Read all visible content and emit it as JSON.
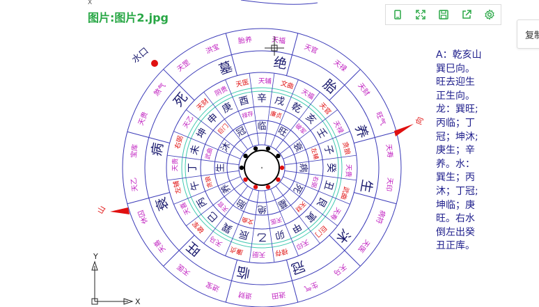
{
  "title": "图片:图片2.jpg",
  "toolbar": {
    "icons": [
      "fit-icon",
      "expand-icon",
      "save-icon",
      "share-icon",
      "settings-icon"
    ]
  },
  "side_tab": {
    "label": "复制"
  },
  "chart": {
    "water_mouth": "水口",
    "left_arrow_label": "山",
    "right_arrow_label": "向",
    "axis_y": "Y",
    "axis_x": "X",
    "stages_outer": [
      "绝",
      "胎",
      "养",
      "生",
      "沐",
      "冠",
      "临",
      "旺",
      "衰",
      "病",
      "死",
      "墓"
    ],
    "mountains": [
      "壬",
      "子",
      "癸",
      "丑",
      "艮",
      "寅",
      "甲",
      "卯",
      "乙",
      "辰",
      "巽",
      "巳",
      "丙",
      "午",
      "丁",
      "未",
      "坤",
      "申",
      "庚",
      "酉",
      "辛",
      "戌",
      "乾",
      "亥"
    ],
    "stages_inner": [
      "绝",
      "胎",
      "养",
      "生",
      "沐",
      "冠",
      "临",
      "旺",
      "衰",
      "病",
      "死",
      "墓"
    ],
    "ring_words": [
      "天辅",
      "文曲",
      "天福",
      "天官",
      "天禄",
      "贪狼",
      "天贵",
      "武曲",
      "天寿",
      "巨门",
      "天印",
      "禄存",
      "天厨",
      "廉贞",
      "天马",
      "破军",
      "天喜",
      "左辅",
      "天贵",
      "右弼",
      "天乙",
      "天财",
      "阴贵",
      "天医"
    ],
    "outer_words": [
      "胎养",
      "天福",
      "天官",
      "天禄",
      "天财",
      "旺气",
      "天寿",
      "天印",
      "病符",
      "天医",
      "天马",
      "生气",
      "进田",
      "退财",
      "进宝",
      "天医",
      "天喜",
      "休囚",
      "天乙",
      "宝库",
      "天贵",
      "煞气",
      "天罡",
      "洪宝"
    ]
  },
  "notes": {
    "lines": [
      "A：乾亥山",
      "巽巳向。",
      "旺去迎生",
      "正生向。",
      "龙：巽旺;",
      "丙临；丁",
      "冠；坤沐;",
      "庚生；辛",
      "养。水：",
      "巽生；丙",
      "沐；丁冠;",
      "坤临；庚",
      "旺。右水",
      "倒左出癸",
      "丑正库。"
    ]
  },
  "colors": {
    "title_green": "#28a745",
    "ring_blue": "#3a3ab8",
    "teal": "#40c9b0",
    "magenta": "#c020c0",
    "red": "#e01010"
  }
}
